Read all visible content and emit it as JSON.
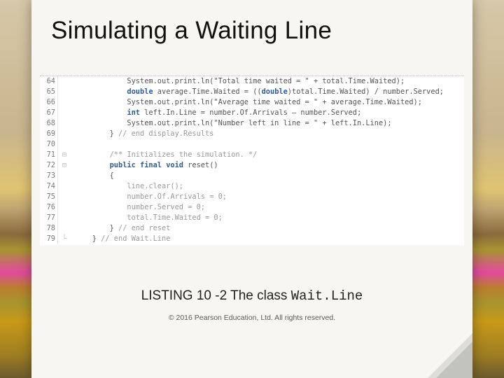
{
  "slide": {
    "title": "Simulating a Waiting Line",
    "caption_prefix": "LISTING 10 -2 The class ",
    "caption_class": "Wait.Line",
    "copyright": "© 2016 Pearson Education, Ltd.  All rights reserved."
  },
  "code": {
    "lines": [
      {
        "n": "64",
        "mk": " ",
        "html": "            System.out.print.ln(\"Total time waited = \" + total.Time.Waited);"
      },
      {
        "n": "65",
        "mk": " ",
        "html": "            <span class=\"kw\">double</span> average.Time.Waited = ((<span class=\"kw\">double</span>)total.Time.Waited) / number.Served;"
      },
      {
        "n": "66",
        "mk": " ",
        "html": "            System.out.print.ln(\"Average time waited = \" + average.Time.Waited);"
      },
      {
        "n": "67",
        "mk": " ",
        "html": "            <span class=\"kw\">int</span> left.In.Line = number.Of.Arrivals – number.Served;"
      },
      {
        "n": "68",
        "mk": " ",
        "html": "            System.out.print.ln(\"Number left in line = \" + left.In.Line);"
      },
      {
        "n": "69",
        "mk": " ",
        "html": "        } <span class=\"cm\">// end display.Results</span>"
      },
      {
        "n": "70",
        "mk": " ",
        "html": ""
      },
      {
        "n": "71",
        "mk": "⊟",
        "html": "        <span class=\"cm\">/** Initializes the simulation. */</span>"
      },
      {
        "n": "72",
        "mk": "⊟",
        "html": "        <span class=\"kw\">public final void</span> reset()"
      },
      {
        "n": "73",
        "mk": " ",
        "html": "        {"
      },
      {
        "n": "74",
        "mk": " ",
        "html": "            <span class=\"gray\">line.clear();</span>"
      },
      {
        "n": "75",
        "mk": " ",
        "html": "            <span class=\"gray\">number.Of.Arrivals = 0;</span>"
      },
      {
        "n": "76",
        "mk": " ",
        "html": "            <span class=\"gray\">number.Served = 0;</span>"
      },
      {
        "n": "77",
        "mk": " ",
        "html": "            <span class=\"gray\">total.Time.Waited = 0;</span>"
      },
      {
        "n": "78",
        "mk": " ",
        "html": "        } <span class=\"cm\">// end reset</span>"
      },
      {
        "n": "79",
        "mk": "└",
        "html": "    } <span class=\"cm\">// end Wait.Line</span>"
      }
    ]
  }
}
